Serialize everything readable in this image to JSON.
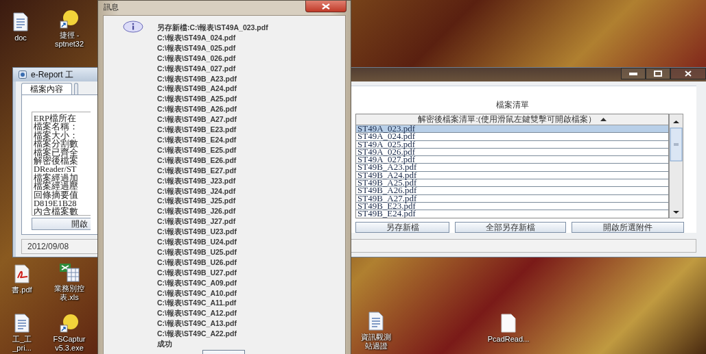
{
  "desktop": {
    "icons": [
      {
        "kind": "document",
        "label": "doc"
      },
      {
        "kind": "shortcut-app",
        "label": "捷徑 -\nsptnet32"
      },
      {
        "kind": "pdf",
        "label": "書.pdf"
      },
      {
        "kind": "spreadsheet",
        "label": "業務別控表.xls"
      },
      {
        "kind": "document",
        "label": "工_工\n_pri..."
      },
      {
        "kind": "shortcut-app",
        "label": "FSCaptur\nv5.3.exe"
      },
      {
        "kind": "document",
        "label": "資訊觀測站過證"
      },
      {
        "kind": "blank-file",
        "label": "PcadRead..."
      }
    ]
  },
  "main_window": {
    "title": "e-Report 工",
    "tabs": [
      {
        "label": "檔案內容",
        "selected": true
      },
      {
        "selected": false
      }
    ],
    "info_lines": [
      "ERP檔所在",
      "檔案名稱：",
      "檔案大小：",
      "檔案分割數",
      "檔案已齊全",
      "解密後檔案",
      "DReader/ST",
      "檔案經過加",
      "檔案經過壓",
      "回條摘要值",
      "D819E1B28",
      "內含檔案數"
    ],
    "open_button": "開啟",
    "status": "2012/09/08",
    "file_list": {
      "title": "檔案清單",
      "column": "解密後檔案清單:(使用滑鼠左鍵雙擊可開啟檔案）",
      "rows": [
        {
          "name": "ST49A_023.pdf",
          "selected": true
        },
        {
          "name": "ST49A_024.pdf",
          "selected": false
        },
        {
          "name": "ST49A_025.pdf",
          "selected": false
        },
        {
          "name": "ST49A_026.pdf",
          "selected": false
        },
        {
          "name": "ST49A_027.pdf",
          "selected": false
        },
        {
          "name": "ST49B_A23.pdf",
          "selected": false
        },
        {
          "name": "ST49B_A24.pdf",
          "selected": false
        },
        {
          "name": "ST49B_A25.pdf",
          "selected": false
        },
        {
          "name": "ST49B_A26.pdf",
          "selected": false
        },
        {
          "name": "ST49B_A27.pdf",
          "selected": false
        },
        {
          "name": "ST49B_E23.pdf",
          "selected": false
        },
        {
          "name": "ST49B_E24.pdf",
          "selected": false
        }
      ],
      "buttons": [
        "另存新檔",
        "全部另存新檔",
        "開啟所選附件"
      ]
    }
  },
  "dialog": {
    "title": "訊息",
    "lines": [
      "另存新檔:C:\\報表\\ST49A_023.pdf",
      "C:\\報表\\ST49A_024.pdf",
      "C:\\報表\\ST49A_025.pdf",
      "C:\\報表\\ST49A_026.pdf",
      "C:\\報表\\ST49A_027.pdf",
      "C:\\報表\\ST49B_A23.pdf",
      "C:\\報表\\ST49B_A24.pdf",
      "C:\\報表\\ST49B_A25.pdf",
      "C:\\報表\\ST49B_A26.pdf",
      "C:\\報表\\ST49B_A27.pdf",
      "C:\\報表\\ST49B_E23.pdf",
      "C:\\報表\\ST49B_E24.pdf",
      "C:\\報表\\ST49B_E25.pdf",
      "C:\\報表\\ST49B_E26.pdf",
      "C:\\報表\\ST49B_E27.pdf",
      "C:\\報表\\ST49B_J23.pdf",
      "C:\\報表\\ST49B_J24.pdf",
      "C:\\報表\\ST49B_J25.pdf",
      "C:\\報表\\ST49B_J26.pdf",
      "C:\\報表\\ST49B_J27.pdf",
      "C:\\報表\\ST49B_U23.pdf",
      "C:\\報表\\ST49B_U24.pdf",
      "C:\\報表\\ST49B_U25.pdf",
      "C:\\報表\\ST49B_U26.pdf",
      "C:\\報表\\ST49B_U27.pdf",
      "C:\\報表\\ST49C_A09.pdf",
      "C:\\報表\\ST49C_A10.pdf",
      "C:\\報表\\ST49C_A11.pdf",
      "C:\\報表\\ST49C_A12.pdf",
      "C:\\報表\\ST49C_A13.pdf",
      "C:\\報表\\ST49C_A22.pdf"
    ],
    "result": "成功"
  }
}
